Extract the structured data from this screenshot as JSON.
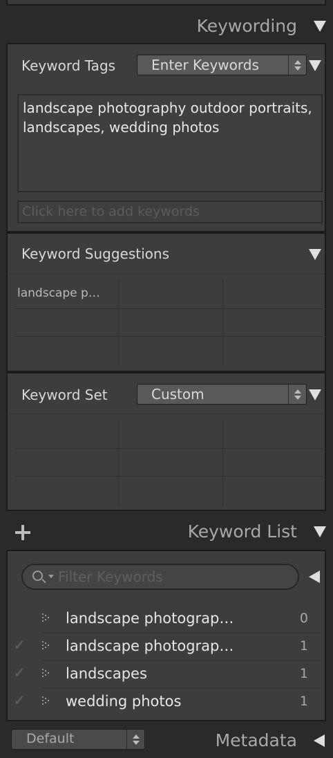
{
  "keywording": {
    "title": "Keywording",
    "keyword_tags": {
      "label": "Keyword Tags",
      "dropdown_value": "Enter Keywords",
      "text": "landscape photography outdoor portraits, landscapes, wedding photos",
      "add_placeholder": "Click here to add keywords"
    },
    "suggestions": {
      "label": "Keyword Suggestions",
      "items": [
        "landscape p…",
        "",
        "",
        "",
        "",
        "",
        "",
        "",
        ""
      ]
    },
    "keyword_set": {
      "label": "Keyword Set",
      "dropdown_value": "Custom",
      "items": [
        "",
        "",
        "",
        "",
        "",
        "",
        "",
        "",
        ""
      ]
    }
  },
  "keyword_list": {
    "add_icon": "plus-icon",
    "title": "Keyword List",
    "filter_placeholder": "Filter Keywords",
    "items": [
      {
        "checked": false,
        "name": "landscape photograp…",
        "count": "0"
      },
      {
        "checked": true,
        "name": "landscape photograp…",
        "count": "1"
      },
      {
        "checked": true,
        "name": "landscapes",
        "count": "1"
      },
      {
        "checked": true,
        "name": "wedding photos",
        "count": "1"
      }
    ]
  },
  "metadata": {
    "preset_value": "Default",
    "title": "Metadata"
  },
  "colors": {
    "panel_bg": "#3d3d3d",
    "app_bg": "#2a2a2a",
    "text_light": "#e6e6e6",
    "text_header": "#a8a8a8"
  }
}
